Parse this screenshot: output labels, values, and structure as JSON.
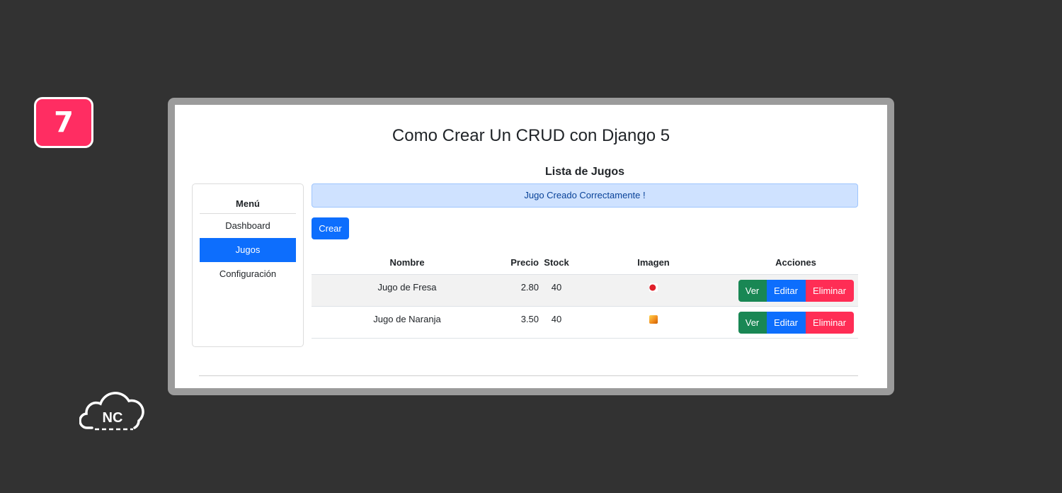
{
  "badge": {
    "number": "7"
  },
  "logo": {
    "text": "NC"
  },
  "app": {
    "title": "Como Crear Un CRUD con Django 5",
    "list_title": "Lista de Jugos"
  },
  "sidebar": {
    "heading": "Menú",
    "items": [
      {
        "label": "Dashboard",
        "active": false
      },
      {
        "label": "Jugos",
        "active": true
      },
      {
        "label": "Configuración",
        "active": false
      }
    ]
  },
  "alert": {
    "message": "Jugo Creado Correctamente !"
  },
  "create_button": {
    "label": "Crear"
  },
  "table": {
    "headers": [
      "Nombre",
      "Precio",
      "Stock",
      "Imagen",
      "Acciones"
    ],
    "rows": [
      {
        "nombre": "Jugo de Fresa",
        "precio": "2.80",
        "stock": "40",
        "imagen": "strawberry-thumbnail"
      },
      {
        "nombre": "Jugo de Naranja",
        "precio": "3.50",
        "stock": "40",
        "imagen": "orange-thumbnail"
      }
    ],
    "actions": {
      "ver": "Ver",
      "editar": "Editar",
      "eliminar": "Eliminar"
    }
  },
  "colors": {
    "background": "#323232",
    "badge": "#ff2d62",
    "primary": "#0d6efd",
    "success": "#198754",
    "danger": "#ff2d55",
    "alert_bg": "#cfe2ff"
  }
}
